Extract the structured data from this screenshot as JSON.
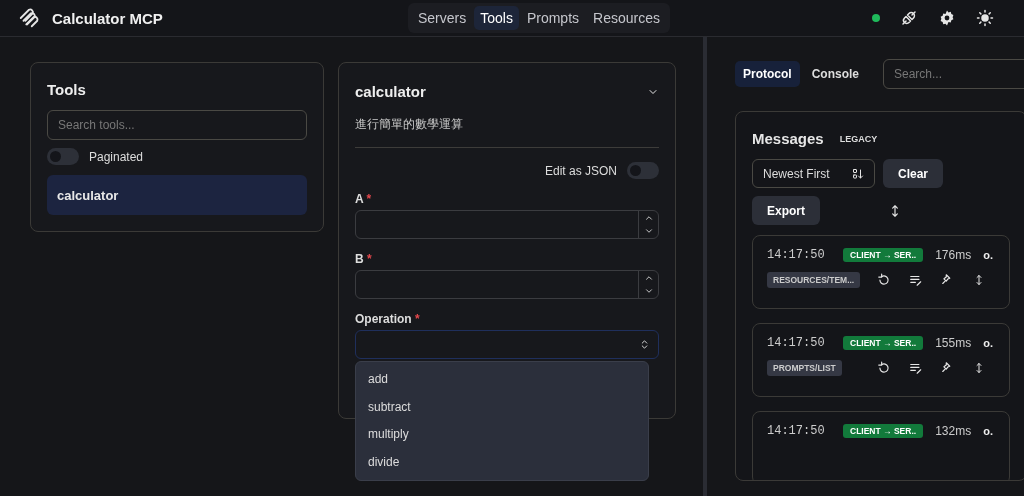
{
  "header": {
    "app_title": "Calculator MCP",
    "nav_tabs": [
      {
        "label": "Servers",
        "selected": false
      },
      {
        "label": "Tools",
        "selected": true
      },
      {
        "label": "Prompts",
        "selected": false
      },
      {
        "label": "Resources",
        "selected": false
      }
    ],
    "connected": true
  },
  "tools_panel": {
    "title": "Tools",
    "search": {
      "placeholder": "Search tools..."
    },
    "paginated": {
      "label": "Paginated",
      "on": false
    },
    "items": [
      {
        "label": "calculator",
        "selected": true
      }
    ]
  },
  "tool_detail": {
    "title": "calculator",
    "description": "進行簡單的數學運算",
    "edit_as_json": {
      "label": "Edit as JSON",
      "on": false
    },
    "fields": [
      {
        "label": "A",
        "required_mark": "*",
        "kind": "number"
      },
      {
        "label": "B",
        "required_mark": "*",
        "kind": "number"
      },
      {
        "label": "Operation",
        "required_mark": "*",
        "kind": "select",
        "focused": true,
        "options": [
          "add",
          "subtract",
          "multiply",
          "divide"
        ]
      }
    ]
  },
  "side": {
    "tabs": [
      {
        "label": "Protocol",
        "selected": true
      },
      {
        "label": "Console",
        "selected": false
      }
    ],
    "search": {
      "placeholder": "Search..."
    },
    "messages": {
      "title": "Messages",
      "badge": "LEGACY",
      "sort": "Newest First",
      "buttons": [
        "Clear",
        "Export"
      ],
      "items": [
        {
          "time": "14:17:50",
          "direction": "CLIENT → SER..",
          "duration": "176ms",
          "extra": "o.",
          "method": "RESOURCES/TEM..."
        },
        {
          "time": "14:17:50",
          "direction": "CLIENT → SER..",
          "duration": "155ms",
          "extra": "o.",
          "method": "PROMPTS/LIST"
        },
        {
          "time": "14:17:50",
          "direction": "CLIENT → SER..",
          "duration": "132ms",
          "extra": "o."
        }
      ]
    }
  }
}
